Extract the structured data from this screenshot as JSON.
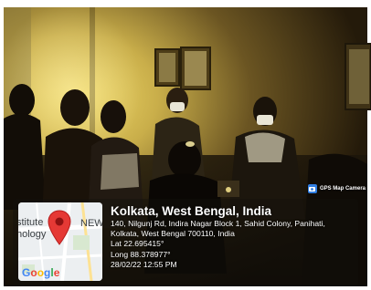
{
  "stamp": {
    "title": "Kolkata, West Bengal, India",
    "address_line1": "140, Nilgunj Rd, Indira Nagar Block 1, Sahid Colony, Panihati,",
    "address_line2": "Kolkata, West Bengal 700110, India",
    "latitude": "Lat 22.695415°",
    "longitude": "Long 88.378977°",
    "datetime": "28/02/22 12:55 PM"
  },
  "badge": {
    "label": "GPS Map Camera",
    "icon": "camera-icon"
  },
  "map": {
    "label_left_top": "stitute",
    "label_left_bottom": "hology",
    "label_right": "NEW",
    "provider": [
      "G",
      "o",
      "o",
      "g",
      "l",
      "e"
    ],
    "pin_color": "#e53935",
    "pin_icon": "location-pin-icon"
  },
  "colors": {
    "stamp_background": "#14100c",
    "badge_icon": "#2f7de1",
    "wall_light": "#d9c25a",
    "wall_dark": "#3a2c10"
  }
}
